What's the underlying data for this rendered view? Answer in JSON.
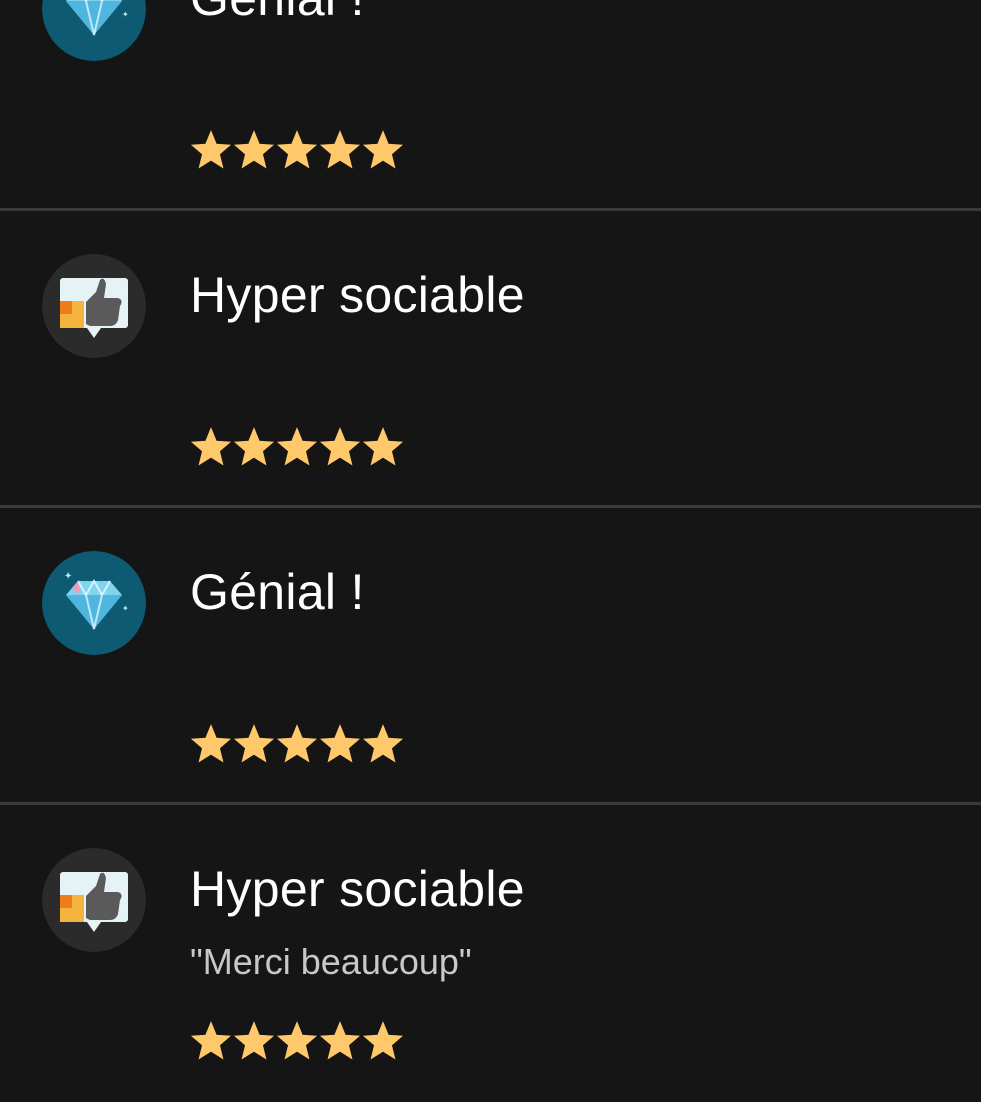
{
  "reviews": [
    {
      "badge_icon": "diamond-icon",
      "title": "Génial !",
      "comment": "",
      "rating": 5,
      "max_rating": 5
    },
    {
      "badge_icon": "thumbs-up-icon",
      "title": "Hyper sociable",
      "comment": "",
      "rating": 5,
      "max_rating": 5
    },
    {
      "badge_icon": "diamond-icon",
      "title": "Génial !",
      "comment": "",
      "rating": 5,
      "max_rating": 5
    },
    {
      "badge_icon": "thumbs-up-icon",
      "title": "Hyper sociable",
      "comment": "\"Merci beaucoup\"",
      "rating": 5,
      "max_rating": 5
    }
  ],
  "colors": {
    "background": "#151515",
    "divider": "#3a3a3a",
    "star": "#ffc96b",
    "diamond_badge_bg": "#0f5a73",
    "thumbs_badge_bg": "#2b2b2b",
    "comment_text": "#c8c8c8"
  }
}
